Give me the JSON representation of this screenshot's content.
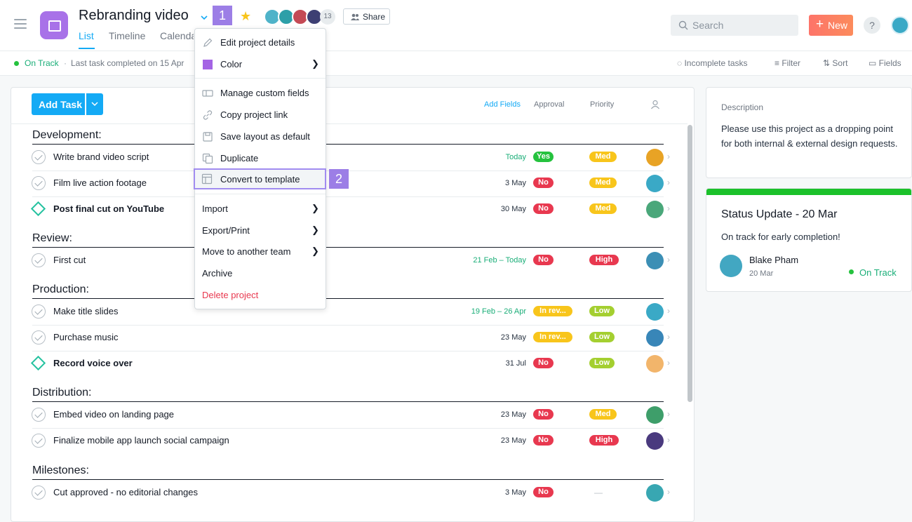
{
  "header": {
    "title": "Rebranding video",
    "star": "★",
    "member_count": "13",
    "share_label": "Share",
    "tabs": [
      "List",
      "Timeline",
      "Calenda"
    ],
    "search_placeholder": "Search",
    "new_label": "New",
    "help": "?"
  },
  "step_badges": [
    "1",
    "2"
  ],
  "subbar": {
    "status": "On Track",
    "last_completed": "Last task completed on 15 Apr",
    "incomplete": "Incomplete tasks",
    "filter": "Filter",
    "sort": "Sort",
    "fields": "Fields"
  },
  "list": {
    "add_task": "Add Task",
    "add_fields": "Add Fields",
    "col_approval": "Approval",
    "col_priority": "Priority",
    "sections": [
      {
        "name": "Development:",
        "tasks": [
          {
            "name": "Write brand video script",
            "date": "Today",
            "approval": "Yes",
            "priority": "Med"
          },
          {
            "name": "Film live action footage",
            "date": "3 May",
            "approval": "No",
            "priority": "Med"
          },
          {
            "name": "Post final cut on YouTube",
            "date": "30 May",
            "approval": "No",
            "priority": "Med"
          }
        ]
      },
      {
        "name": "Review:",
        "tasks": [
          {
            "name": "First cut",
            "date": "21 Feb – Today",
            "approval": "No",
            "priority": "High"
          }
        ]
      },
      {
        "name": "Production:",
        "tasks": [
          {
            "name": "Make title slides",
            "date": "19 Feb – 26 Apr",
            "approval": "In rev...",
            "priority": "Low"
          },
          {
            "name": "Purchase music",
            "date": "23 May",
            "approval": "In rev...",
            "priority": "Low"
          },
          {
            "name": "Record voice over",
            "date": "31 Jul",
            "approval": "No",
            "priority": "Low"
          }
        ]
      },
      {
        "name": "Distribution:",
        "tasks": [
          {
            "name": "Embed video on landing page",
            "date": "23 May",
            "approval": "No",
            "priority": "Med"
          },
          {
            "name": "Finalize mobile app launch social campaign",
            "date": "23 May",
            "approval": "No",
            "priority": "High"
          }
        ]
      },
      {
        "name": "Milestones:",
        "tasks": [
          {
            "name": "Cut approved - no editorial changes",
            "date": "3 May",
            "approval": "No",
            "priority": "—"
          }
        ]
      }
    ]
  },
  "description": {
    "label": "Description",
    "text": "Please use this project as a dropping point for both internal & external design requests."
  },
  "status_update": {
    "title": "Status Update - 20 Mar",
    "body": "On track for early completion!",
    "author": "Blake Pham",
    "date": "20 Mar",
    "status": "On Track"
  },
  "menu": {
    "items": [
      "Edit project details",
      "Color",
      "Manage custom fields",
      "Copy project link",
      "Save layout as default",
      "Duplicate",
      "Convert to template",
      "Import",
      "Export/Print",
      "Move to another team",
      "Archive",
      "Delete project"
    ]
  },
  "colors": {
    "accent": "#14aaf5",
    "purple": "#a872e8",
    "green": "#25c23e",
    "red": "#e8384f",
    "yellow": "#f8c51b",
    "lime": "#a4cf30",
    "teal": "#25c2a0",
    "delete": "#e8384f"
  }
}
